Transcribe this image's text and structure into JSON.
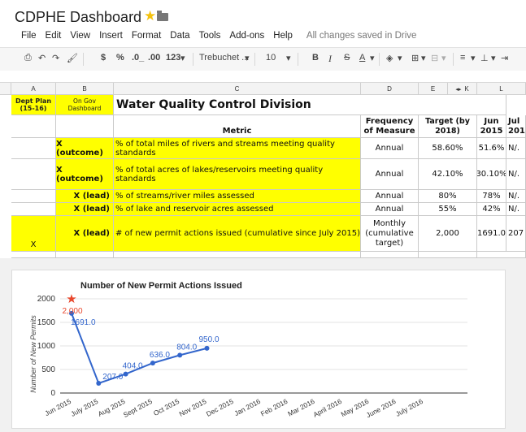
{
  "app": {
    "title": "CDPHE Dashboard",
    "save_status": "All changes saved in Drive"
  },
  "menus": [
    "File",
    "Edit",
    "View",
    "Insert",
    "Format",
    "Data",
    "Tools",
    "Add-ons",
    "Help"
  ],
  "toolbar": {
    "currency": "$",
    "percent": "%",
    "dec_less": ".0_",
    "dec_more": ".00",
    "more_formats": "123",
    "font": "Trebuchet ...",
    "font_size": "10",
    "bold": "B",
    "italic": "I",
    "strike": "S",
    "text_color": "A"
  },
  "columns": [
    "A",
    "B",
    "C",
    "D",
    "E",
    "K",
    "L"
  ],
  "header_row": {
    "a": "Dept Plan (15-16)",
    "b": "On Gov Dashboard",
    "title": "Water Quality Control Division"
  },
  "subheader": {
    "metric": "Metric",
    "frequency": "Frequency of Measure",
    "target": "Target (by 2018)",
    "jun": "Jun 2015",
    "jul": "Jul 201"
  },
  "rows": [
    {
      "a": "",
      "b": "X (outcome)",
      "metric": "% of total miles of rivers and streams meeting quality standards",
      "freq": "Annual",
      "target": "58.60%",
      "jun": "51.6%",
      "jul": "N/."
    },
    {
      "a": "",
      "b": "X (outcome)",
      "metric": "% of total acres of lakes/reservoirs meeting quality standards",
      "freq": "Annual",
      "target": "42.10%",
      "jun": "30.10%",
      "jul": "N/."
    },
    {
      "a": "",
      "b": "X (lead)",
      "metric": "% of streams/river miles assessed",
      "freq": "Annual",
      "target": "80%",
      "jun": "78%",
      "jul": "N/."
    },
    {
      "a": "",
      "b": "X (lead)",
      "metric": "% of lake and reservoir acres assessed",
      "freq": "Annual",
      "target": "55%",
      "jun": "42%",
      "jul": "N/."
    },
    {
      "a": "X",
      "b": "X (lead)",
      "metric": "# of new permit actions issued (cumulative since July 2015)",
      "freq": "Monthly (cumulative target)",
      "target": "2,000",
      "jun": "1691.0",
      "jul": "207"
    }
  ],
  "colors": {
    "yellow": "#ffff00",
    "line": "#3366cc",
    "target": "#e8462b"
  },
  "chart_data": {
    "type": "line",
    "title": "Number of New Permit Actions Issued",
    "ylabel": "Number of New Permits",
    "xlabel": "",
    "ylim": [
      0,
      2000
    ],
    "yticks": [
      0,
      500,
      1000,
      1500,
      2000
    ],
    "categories": [
      "Jun 2015",
      "July 2015",
      "Aug 2015",
      "Sept 2015",
      "Oct 2015",
      "Nov 2015",
      "Dec 2015",
      "Jan 2016",
      "Feb 2016",
      "Mar 2016",
      "April 2016",
      "May 2016",
      "June 2016",
      "July 2016"
    ],
    "series": [
      {
        "values": [
          1691.0,
          207.0,
          404.0,
          636.0,
          804.0,
          950.0,
          null,
          null,
          null,
          null,
          null,
          null,
          null,
          null
        ],
        "labels": [
          "1691.0",
          "207.0",
          "404.0",
          "636.0",
          "804.0",
          "950.0"
        ],
        "color": "#3366cc"
      },
      {
        "values": [
          2000
        ],
        "labels": [
          "2,000"
        ],
        "color": "#e8462b",
        "marker": "star"
      }
    ]
  }
}
